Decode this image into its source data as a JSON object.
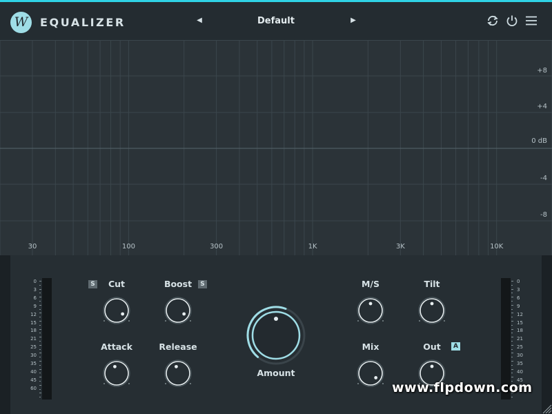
{
  "app": {
    "title": "EQUALIZER",
    "logo_letter": "W"
  },
  "header": {
    "preset": "Default",
    "prev_icon": "triangle-left-icon",
    "next_icon": "triangle-right-icon",
    "icons": [
      "undo-redo-icon",
      "power-icon",
      "menu-icon"
    ]
  },
  "graph": {
    "db_labels": [
      "+8",
      "+4",
      "0 dB",
      "-4",
      "-8"
    ],
    "freq_labels": [
      "30",
      "100",
      "300",
      "1K",
      "3K",
      "10K"
    ]
  },
  "meters": {
    "scale": [
      "0",
      "3",
      "6",
      "9",
      "12",
      "15",
      "18",
      "21",
      "25",
      "30",
      "35",
      "40",
      "45",
      "60"
    ]
  },
  "knobs": {
    "cut": {
      "label": "Cut",
      "badge": "S"
    },
    "boost": {
      "label": "Boost",
      "badge": "S"
    },
    "attack": {
      "label": "Attack"
    },
    "release": {
      "label": "Release"
    },
    "amount": {
      "label": "Amount"
    },
    "ms": {
      "label": "M/S"
    },
    "tilt": {
      "label": "Tilt"
    },
    "mix": {
      "label": "Mix"
    },
    "out": {
      "label": "Out",
      "badge": "A"
    }
  },
  "watermark": "www.flpdown.com",
  "colors": {
    "accent": "#2fd3e6",
    "knob_accent": "#9fdde6",
    "background": "#22292e"
  }
}
